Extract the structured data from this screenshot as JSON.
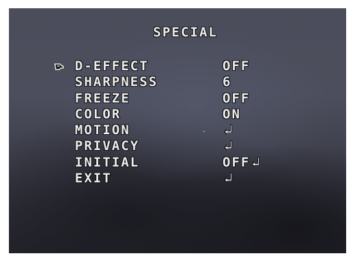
{
  "osd": {
    "title": "SPECIAL",
    "items": [
      {
        "label": "D-EFFECT",
        "value": "OFF",
        "enter": false,
        "selected": true
      },
      {
        "label": "SHARPNESS",
        "value": "6",
        "enter": false,
        "selected": false
      },
      {
        "label": "FREEZE",
        "value": "OFF",
        "enter": false,
        "selected": false
      },
      {
        "label": "COLOR",
        "value": "ON",
        "enter": false,
        "selected": false
      },
      {
        "label": "MOTION",
        "value": "",
        "enter": true,
        "selected": false
      },
      {
        "label": "PRIVACY",
        "value": "",
        "enter": true,
        "selected": false
      },
      {
        "label": "INITIAL",
        "value": "OFF",
        "enter": true,
        "selected": false
      },
      {
        "label": "EXIT",
        "value": "",
        "enter": true,
        "selected": false
      }
    ],
    "icons": {
      "cursor": "pointing-hand-icon",
      "enter": "enter-arrow-icon"
    },
    "colors": {
      "text": "#ececec",
      "outline": "#111111",
      "background": "#4b4d5b"
    }
  }
}
